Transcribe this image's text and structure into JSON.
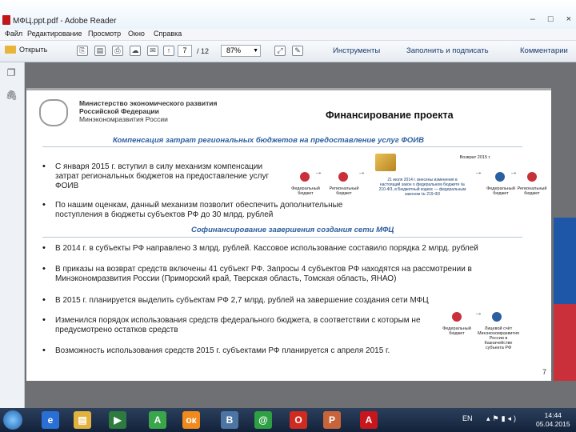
{
  "window": {
    "title": "МФЦ.ppt.pdf - Adobe Reader",
    "controls": {
      "minimize": "–",
      "maximize": "□",
      "close": "×"
    }
  },
  "menu": [
    "Файл",
    "Редактирование",
    "Просмотр",
    "Окно",
    "Справка"
  ],
  "toolbar": {
    "open_label": "Открыть",
    "page_current": "7",
    "page_total": "/ 12",
    "zoom": "87%",
    "tools_label": "Инструменты",
    "fill_sign_label": "Заполнить и подписать",
    "comment_label": "Комментарии"
  },
  "slide": {
    "ministry_line1": "Министерство экономического развития",
    "ministry_line2": "Российской Федерации",
    "ministry_line3": "Минэкономразвития России",
    "headline": "Финансирование проекта",
    "subheading1": "Компенсация затрат региональных бюджетов на предоставление услуг ФОИВ",
    "subheading2": "Софинансирование завершения создания сети МФЦ",
    "bullets": [
      "С января 2015 г. вступил в силу механизм компенсации затрат региональных бюджетов на предоставление услуг ФОИВ",
      "По нашим оценкам, данный механизм позволит обеспечить дополнительные поступления в бюджеты субъектов РФ до 30 млрд. рублей",
      "В 2014 г. в субъекты РФ направлено 3 млрд. рублей. Кассовое использование составило порядка 2 млрд. рублей",
      "В приказы на возврат средств включены 41 субъект РФ. Запросы 4 субъектов РФ находятся на рассмотрении в Минэкономразвития России (Приморский край, Тверская область, Томская область, ЯНАО)",
      "В 2015 г. планируется выделить субъектам РФ 2,7 млрд. рублей на завершение создания сети МФЦ",
      "Изменился порядок использования средств федерального бюджета, в соответствии с которым не предусмотрено остатков средств",
      "Возможность использования средств 2015 г. субъектами РФ планируется с апреля 2015 г."
    ],
    "diagram_top": {
      "cap_federal": "Федеральный бюджет",
      "cap_regional": "Региональный бюджет",
      "cap_note": "21 июля 2014 г. внесены изменения в настоящий закон о федеральном бюджете № 210-ФЗ, в Бюджетный кодекс — федеральным законом № 219-ФЗ",
      "cap_return": "Возврат 2015 г.",
      "cap_fed2": "Федеральный бюджет",
      "cap_reg2": "Региональный бюджет"
    },
    "diagram_bottom": {
      "cap_left": "Федеральный бюджет",
      "cap_right": "Лицевой счёт Минэкономразвития России в Казначействе субъекта РФ"
    },
    "page_number": "7"
  },
  "taskbar": {
    "lang": "EN",
    "time": "14:44",
    "date": "05.04.2015"
  }
}
